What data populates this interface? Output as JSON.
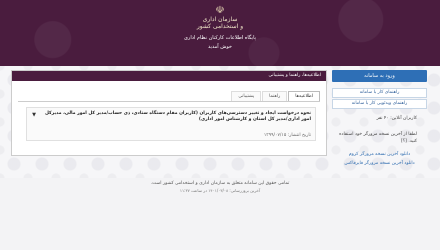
{
  "header": {
    "emblem_icon": "iran-emblem-icon",
    "org_line1": "سازمان اداری",
    "org_line2": "و استخدامی کشور",
    "site_title": "پایگاه اطلاعات کارکنان نظام اداری",
    "site_subtitle": "خوش آمدید"
  },
  "sidebar": {
    "login_label": "ورود به سامانه",
    "guide_system": "راهنمای کار با سامانه",
    "guide_video": "راهنمای ویدئویی کار با سامانه",
    "visitors_text": "کاربران آنلاین: ۴۰ نفر",
    "browser_note": "لطفا از آخرین نسخه مرورگر خود استفاده کنید. [؟]",
    "download_chrome": "دانلود آخرین نسخه مرورگر کروم",
    "download_firefox": "دانلود آخرین نسخه مرورگر فایرفاکس"
  },
  "panel": {
    "header": "اطلاعیه‌ها، راهنما و پشتیبانی",
    "tabs": [
      "اطلاعیه‌ها",
      "راهنما",
      "پشتیبانی"
    ],
    "announcement_title": "نحوه درخواست ایجاد و تغییر دسترسی‌های کاربران (کاربران مقام دستگاه ستادی، ذی حساب/مدیر کل امور مالی، مدیرکل امور اداری/مدیر کل استان و کارشناس امور اداری)",
    "announcement_date": "تاریخ انتشار: ۱۳۹۹/۰۷/۱۵"
  },
  "footer": {
    "line1": "تمامی حقوق این سامانه متعلق به سازمان اداری و استخدامی کشور است.",
    "line2": "آخرین بروزرسانی: ۱۴۰۱/۰۳/۰۸ در ساعت ۱۱:۳۷"
  }
}
